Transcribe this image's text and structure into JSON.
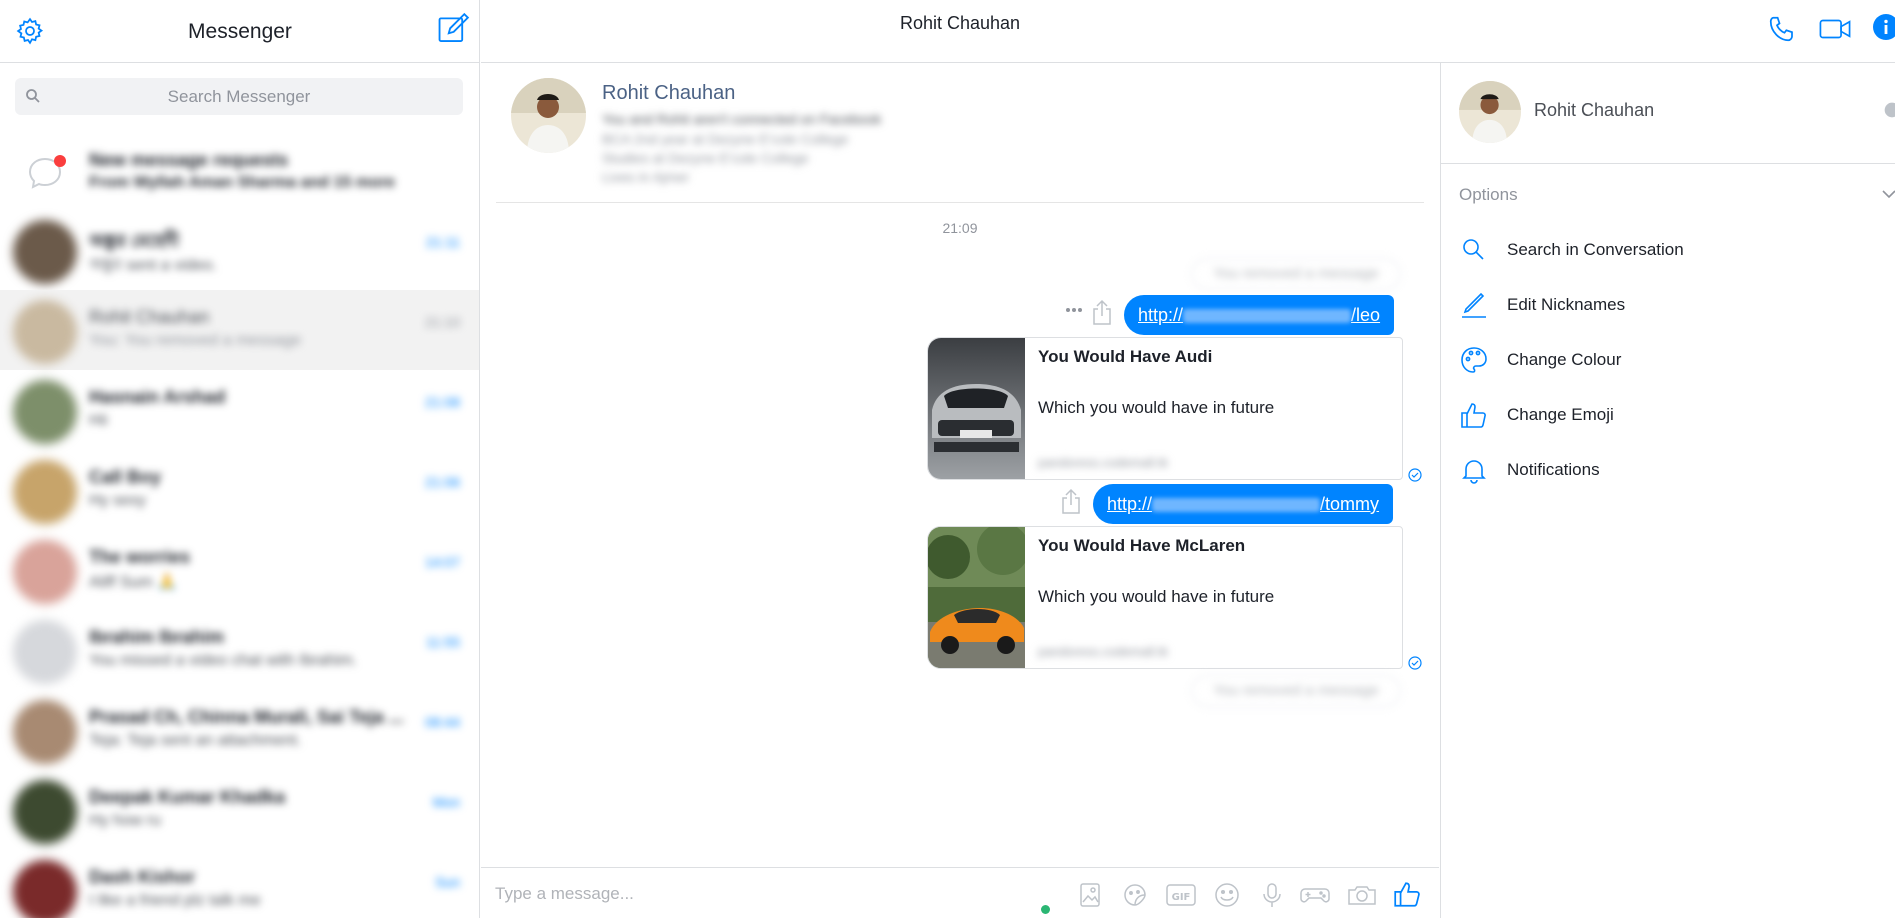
{
  "sidebar": {
    "title": "Messenger",
    "search_placeholder": "Search Messenger",
    "requests": {
      "title": "New message requests",
      "subtitle": "From Wyllah Aman Sharma and 15 more"
    },
    "conversations": [
      {
        "name": "অঙ্কুর মেহেদী",
        "snippet": "অঙ্কুর sent a video.",
        "time": "21:11",
        "avatar_color": "#6b5a4a"
      },
      {
        "name": "Rohit Chauhan",
        "snippet": "You: You removed a message",
        "time": "21:10",
        "avatar_color": "#c9b9a0"
      },
      {
        "name": "Hasnain Arshad",
        "snippet": "Hii",
        "time": "21:08",
        "avatar_color": "#7d8f6a"
      },
      {
        "name": "Call Boy",
        "snippet": "Hy sexy",
        "time": "21:06",
        "avatar_color": "#c7a46a"
      },
      {
        "name": "The worries",
        "snippet": "Aliff Sum 🙏",
        "time": "14:07",
        "avatar_color": "#d9a39a"
      },
      {
        "name": "Ibrahim Ibrahim",
        "snippet": "You missed a video chat with Ibrahim.",
        "time": "11:55",
        "avatar_color": "#d6d8dc"
      },
      {
        "name": "Prasad Ch, Chinna Murali, Sai Teja ...",
        "snippet": "Teja: Teja sent an attachment.",
        "time": "08:44",
        "avatar_color": "#a88a72"
      },
      {
        "name": "Deepak Kumar Khadka",
        "snippet": "Hy how ru",
        "time": "Mon",
        "avatar_color": "#3d4a30"
      },
      {
        "name": "Dash Kishor",
        "snippet": "I like a friend plz talk me",
        "time": "Sun",
        "avatar_color": "#7a2a2a"
      }
    ]
  },
  "chat": {
    "header_title": "Rohit Chauhan",
    "profile": {
      "name": "Rohit Chauhan",
      "line1": "You and Rohit aren't connected on Facebook",
      "line2": "BCA 2nd year at Dezyne E'cole College",
      "line3": "Studies at Dezyne E'cole College",
      "line4": "Lives in Ajmer"
    },
    "timestamp": "21:09",
    "removed_text": "You removed a message",
    "messages": [
      {
        "link_prefix": "http://",
        "link_suffix": "/leo",
        "card_title": "You Would Have Audi",
        "card_desc": "Which you would have in future",
        "card_domain": "pandoress.codemall.tk"
      },
      {
        "link_prefix": "http://",
        "link_suffix": "/tommy",
        "card_title": "You Would Have McLaren",
        "card_desc": "Which you would have in future",
        "card_domain": "pandoress.codemall.tk"
      }
    ],
    "composer_placeholder": "Type a message...",
    "tools": [
      "photo-icon",
      "sticker-icon",
      "gif-icon",
      "emoji-icon",
      "microphone-icon",
      "game-icon",
      "camera-icon",
      "thumbs-up-icon"
    ]
  },
  "info_panel": {
    "name": "Rohit Chauhan",
    "options_title": "Options",
    "options": [
      {
        "label": "Search in Conversation",
        "icon": "search-icon"
      },
      {
        "label": "Edit Nicknames",
        "icon": "pencil-icon"
      },
      {
        "label": "Change Colour",
        "icon": "palette-icon"
      },
      {
        "label": "Change Emoji",
        "icon": "thumbs-up-icon"
      },
      {
        "label": "Notifications",
        "icon": "bell-icon"
      }
    ]
  },
  "colors": {
    "accent": "#0084ff",
    "active_dot": "#2bb673"
  }
}
